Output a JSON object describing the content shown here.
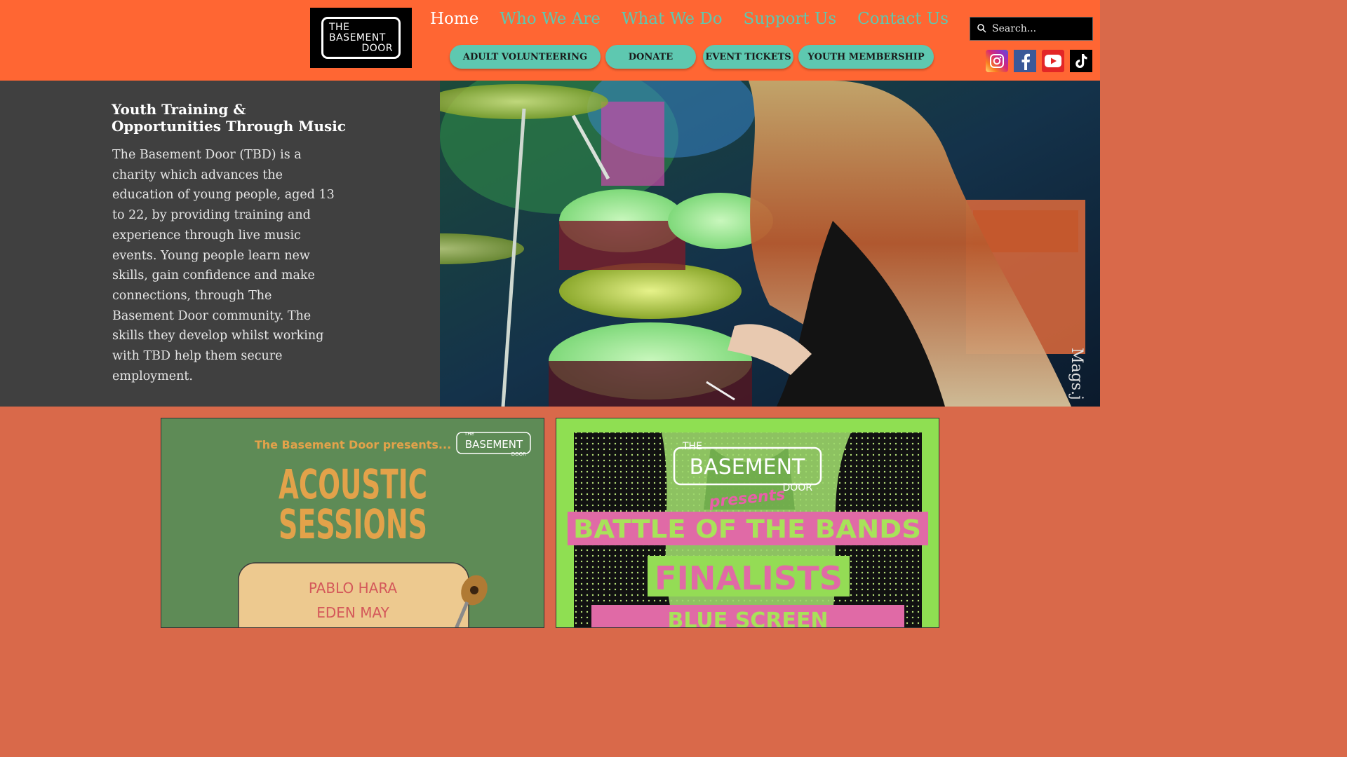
{
  "header": {
    "logo": {
      "line1": "THE",
      "line2": "BASEMENT",
      "line3": "DOOR"
    },
    "nav": [
      {
        "label": "Home",
        "active": true
      },
      {
        "label": "Who We Are"
      },
      {
        "label": "What We Do"
      },
      {
        "label": "Support Us"
      },
      {
        "label": "Contact Us"
      }
    ],
    "buttons": [
      {
        "label": "ADULT VOLUNTEERING"
      },
      {
        "label": "DONATE"
      },
      {
        "label": "EVENT TICKETS"
      },
      {
        "label": "YOUTH MEMBERSHIP"
      }
    ],
    "search": {
      "placeholder": "Search..."
    },
    "socials": [
      "instagram-icon",
      "facebook-icon",
      "youtube-icon",
      "tiktok-icon"
    ]
  },
  "hero": {
    "title_line1": "Youth Training &",
    "title_line2": "Opportunities Through Music",
    "body": "The Basement Door (TBD) is a charity which advances the education of young people, aged 13 to 22, by providing training and experience through live music events. Young people learn new skills, gain confidence and make connections, through The Basement Door community. The skills they develop whilst working with TBD help them secure employment.",
    "photo_credit": "Mags.j"
  },
  "poster_acoustic": {
    "presents": "The Basement Door presents...",
    "title_line1": "ACOUSTIC",
    "title_line2": "SESSIONS",
    "artist1": "PABLO HARA",
    "artist2": "EDEN MAY",
    "logo_the": "THE",
    "logo_main": "BASEMENT",
    "logo_door": "DOOR"
  },
  "poster_battle": {
    "logo_the": "THE",
    "logo_main": "BASEMENT",
    "logo_door": "DOOR",
    "presents": "presents",
    "title": "BATTLE OF THE BANDS",
    "subtitle": "FINALISTS",
    "band": "BLUE SCREEN"
  },
  "colors": {
    "header_bg": "#ff6633",
    "accent_teal": "#5ec8b0",
    "hero_panel": "#404040",
    "page_bg": "#d9694a"
  }
}
